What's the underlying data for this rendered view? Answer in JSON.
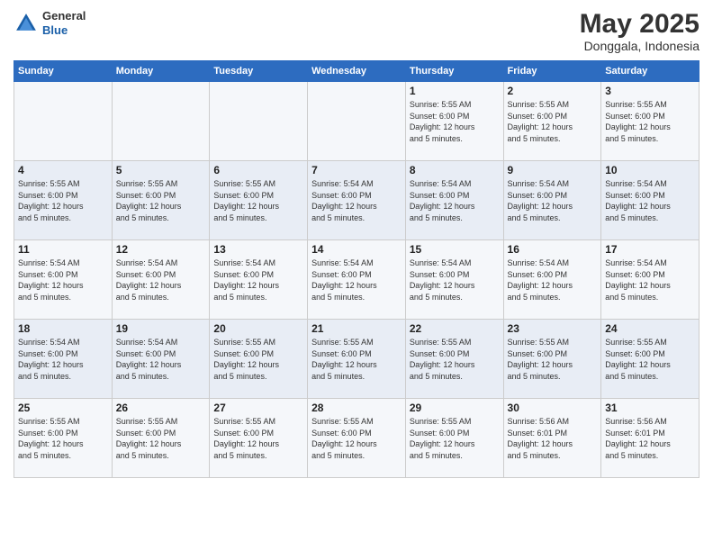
{
  "logo": {
    "general": "General",
    "blue": "Blue"
  },
  "header": {
    "title": "May 2025",
    "subtitle": "Donggala, Indonesia"
  },
  "weekdays": [
    "Sunday",
    "Monday",
    "Tuesday",
    "Wednesday",
    "Thursday",
    "Friday",
    "Saturday"
  ],
  "weeks": [
    [
      {
        "day": "",
        "info": ""
      },
      {
        "day": "",
        "info": ""
      },
      {
        "day": "",
        "info": ""
      },
      {
        "day": "",
        "info": ""
      },
      {
        "day": "1",
        "info": "Sunrise: 5:55 AM\nSunset: 6:00 PM\nDaylight: 12 hours\nand 5 minutes."
      },
      {
        "day": "2",
        "info": "Sunrise: 5:55 AM\nSunset: 6:00 PM\nDaylight: 12 hours\nand 5 minutes."
      },
      {
        "day": "3",
        "info": "Sunrise: 5:55 AM\nSunset: 6:00 PM\nDaylight: 12 hours\nand 5 minutes."
      }
    ],
    [
      {
        "day": "4",
        "info": "Sunrise: 5:55 AM\nSunset: 6:00 PM\nDaylight: 12 hours\nand 5 minutes."
      },
      {
        "day": "5",
        "info": "Sunrise: 5:55 AM\nSunset: 6:00 PM\nDaylight: 12 hours\nand 5 minutes."
      },
      {
        "day": "6",
        "info": "Sunrise: 5:55 AM\nSunset: 6:00 PM\nDaylight: 12 hours\nand 5 minutes."
      },
      {
        "day": "7",
        "info": "Sunrise: 5:54 AM\nSunset: 6:00 PM\nDaylight: 12 hours\nand 5 minutes."
      },
      {
        "day": "8",
        "info": "Sunrise: 5:54 AM\nSunset: 6:00 PM\nDaylight: 12 hours\nand 5 minutes."
      },
      {
        "day": "9",
        "info": "Sunrise: 5:54 AM\nSunset: 6:00 PM\nDaylight: 12 hours\nand 5 minutes."
      },
      {
        "day": "10",
        "info": "Sunrise: 5:54 AM\nSunset: 6:00 PM\nDaylight: 12 hours\nand 5 minutes."
      }
    ],
    [
      {
        "day": "11",
        "info": "Sunrise: 5:54 AM\nSunset: 6:00 PM\nDaylight: 12 hours\nand 5 minutes."
      },
      {
        "day": "12",
        "info": "Sunrise: 5:54 AM\nSunset: 6:00 PM\nDaylight: 12 hours\nand 5 minutes."
      },
      {
        "day": "13",
        "info": "Sunrise: 5:54 AM\nSunset: 6:00 PM\nDaylight: 12 hours\nand 5 minutes."
      },
      {
        "day": "14",
        "info": "Sunrise: 5:54 AM\nSunset: 6:00 PM\nDaylight: 12 hours\nand 5 minutes."
      },
      {
        "day": "15",
        "info": "Sunrise: 5:54 AM\nSunset: 6:00 PM\nDaylight: 12 hours\nand 5 minutes."
      },
      {
        "day": "16",
        "info": "Sunrise: 5:54 AM\nSunset: 6:00 PM\nDaylight: 12 hours\nand 5 minutes."
      },
      {
        "day": "17",
        "info": "Sunrise: 5:54 AM\nSunset: 6:00 PM\nDaylight: 12 hours\nand 5 minutes."
      }
    ],
    [
      {
        "day": "18",
        "info": "Sunrise: 5:54 AM\nSunset: 6:00 PM\nDaylight: 12 hours\nand 5 minutes."
      },
      {
        "day": "19",
        "info": "Sunrise: 5:54 AM\nSunset: 6:00 PM\nDaylight: 12 hours\nand 5 minutes."
      },
      {
        "day": "20",
        "info": "Sunrise: 5:55 AM\nSunset: 6:00 PM\nDaylight: 12 hours\nand 5 minutes."
      },
      {
        "day": "21",
        "info": "Sunrise: 5:55 AM\nSunset: 6:00 PM\nDaylight: 12 hours\nand 5 minutes."
      },
      {
        "day": "22",
        "info": "Sunrise: 5:55 AM\nSunset: 6:00 PM\nDaylight: 12 hours\nand 5 minutes."
      },
      {
        "day": "23",
        "info": "Sunrise: 5:55 AM\nSunset: 6:00 PM\nDaylight: 12 hours\nand 5 minutes."
      },
      {
        "day": "24",
        "info": "Sunrise: 5:55 AM\nSunset: 6:00 PM\nDaylight: 12 hours\nand 5 minutes."
      }
    ],
    [
      {
        "day": "25",
        "info": "Sunrise: 5:55 AM\nSunset: 6:00 PM\nDaylight: 12 hours\nand 5 minutes."
      },
      {
        "day": "26",
        "info": "Sunrise: 5:55 AM\nSunset: 6:00 PM\nDaylight: 12 hours\nand 5 minutes."
      },
      {
        "day": "27",
        "info": "Sunrise: 5:55 AM\nSunset: 6:00 PM\nDaylight: 12 hours\nand 5 minutes."
      },
      {
        "day": "28",
        "info": "Sunrise: 5:55 AM\nSunset: 6:00 PM\nDaylight: 12 hours\nand 5 minutes."
      },
      {
        "day": "29",
        "info": "Sunrise: 5:55 AM\nSunset: 6:00 PM\nDaylight: 12 hours\nand 5 minutes."
      },
      {
        "day": "30",
        "info": "Sunrise: 5:56 AM\nSunset: 6:01 PM\nDaylight: 12 hours\nand 5 minutes."
      },
      {
        "day": "31",
        "info": "Sunrise: 5:56 AM\nSunset: 6:01 PM\nDaylight: 12 hours\nand 5 minutes."
      }
    ]
  ]
}
